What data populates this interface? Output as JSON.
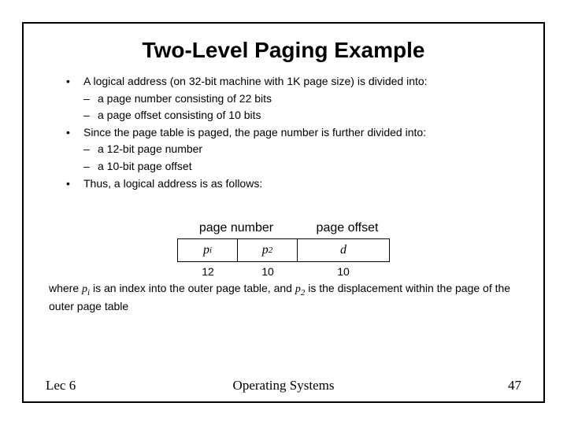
{
  "title": "Two-Level Paging Example",
  "bullets": {
    "b1": "A logical address (on 32-bit machine with 1K page size) is divided into:",
    "b1a": "a page number consisting of 22 bits",
    "b1b": "a page offset consisting of 10 bits",
    "b2": "Since the page table is paged, the page number is further divided into:",
    "b2a": "a 12-bit page number",
    "b2b": "a 10-bit page offset",
    "b3": "Thus, a logical address is as follows:"
  },
  "diagram": {
    "header_left": "page number",
    "header_right": "page offset",
    "p1_base": "p",
    "p1_sub": "i",
    "p2_base": "p",
    "p2_sub": "2",
    "d": "d",
    "bits_p1": "12",
    "bits_p2": "10",
    "bits_d": "10"
  },
  "caption": {
    "pre": "where ",
    "pi_base": "p",
    "pi_sub": "i",
    "mid1": " is an index into the outer page table, and ",
    "p2_base": "p",
    "p2_sub": "2",
    "mid2": " is the displacement within the page of the outer page table"
  },
  "footer": {
    "left": "Lec 6",
    "center": "Operating Systems",
    "right": "47"
  }
}
